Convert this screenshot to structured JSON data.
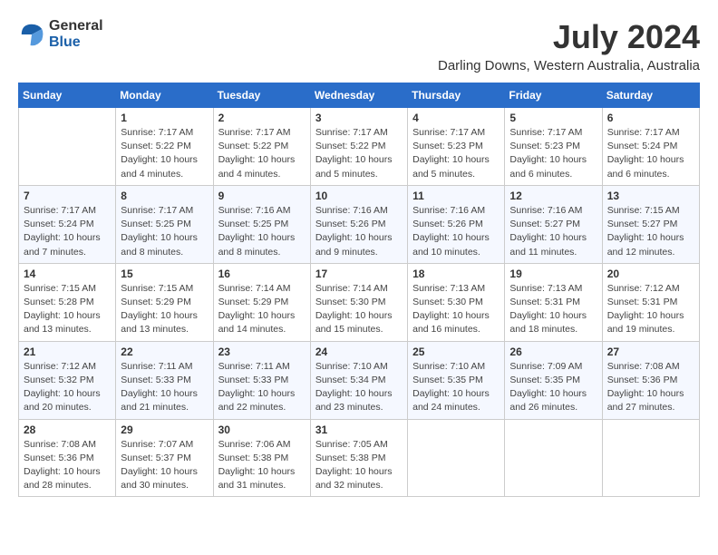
{
  "header": {
    "logo_line1": "General",
    "logo_line2": "Blue",
    "month": "July 2024",
    "location": "Darling Downs, Western Australia, Australia"
  },
  "days_of_week": [
    "Sunday",
    "Monday",
    "Tuesday",
    "Wednesday",
    "Thursday",
    "Friday",
    "Saturday"
  ],
  "weeks": [
    [
      {
        "day": "",
        "info": ""
      },
      {
        "day": "1",
        "info": "Sunrise: 7:17 AM\nSunset: 5:22 PM\nDaylight: 10 hours\nand 4 minutes."
      },
      {
        "day": "2",
        "info": "Sunrise: 7:17 AM\nSunset: 5:22 PM\nDaylight: 10 hours\nand 4 minutes."
      },
      {
        "day": "3",
        "info": "Sunrise: 7:17 AM\nSunset: 5:22 PM\nDaylight: 10 hours\nand 5 minutes."
      },
      {
        "day": "4",
        "info": "Sunrise: 7:17 AM\nSunset: 5:23 PM\nDaylight: 10 hours\nand 5 minutes."
      },
      {
        "day": "5",
        "info": "Sunrise: 7:17 AM\nSunset: 5:23 PM\nDaylight: 10 hours\nand 6 minutes."
      },
      {
        "day": "6",
        "info": "Sunrise: 7:17 AM\nSunset: 5:24 PM\nDaylight: 10 hours\nand 6 minutes."
      }
    ],
    [
      {
        "day": "7",
        "info": "Sunrise: 7:17 AM\nSunset: 5:24 PM\nDaylight: 10 hours\nand 7 minutes."
      },
      {
        "day": "8",
        "info": "Sunrise: 7:17 AM\nSunset: 5:25 PM\nDaylight: 10 hours\nand 8 minutes."
      },
      {
        "day": "9",
        "info": "Sunrise: 7:16 AM\nSunset: 5:25 PM\nDaylight: 10 hours\nand 8 minutes."
      },
      {
        "day": "10",
        "info": "Sunrise: 7:16 AM\nSunset: 5:26 PM\nDaylight: 10 hours\nand 9 minutes."
      },
      {
        "day": "11",
        "info": "Sunrise: 7:16 AM\nSunset: 5:26 PM\nDaylight: 10 hours\nand 10 minutes."
      },
      {
        "day": "12",
        "info": "Sunrise: 7:16 AM\nSunset: 5:27 PM\nDaylight: 10 hours\nand 11 minutes."
      },
      {
        "day": "13",
        "info": "Sunrise: 7:15 AM\nSunset: 5:27 PM\nDaylight: 10 hours\nand 12 minutes."
      }
    ],
    [
      {
        "day": "14",
        "info": "Sunrise: 7:15 AM\nSunset: 5:28 PM\nDaylight: 10 hours\nand 13 minutes."
      },
      {
        "day": "15",
        "info": "Sunrise: 7:15 AM\nSunset: 5:29 PM\nDaylight: 10 hours\nand 13 minutes."
      },
      {
        "day": "16",
        "info": "Sunrise: 7:14 AM\nSunset: 5:29 PM\nDaylight: 10 hours\nand 14 minutes."
      },
      {
        "day": "17",
        "info": "Sunrise: 7:14 AM\nSunset: 5:30 PM\nDaylight: 10 hours\nand 15 minutes."
      },
      {
        "day": "18",
        "info": "Sunrise: 7:13 AM\nSunset: 5:30 PM\nDaylight: 10 hours\nand 16 minutes."
      },
      {
        "day": "19",
        "info": "Sunrise: 7:13 AM\nSunset: 5:31 PM\nDaylight: 10 hours\nand 18 minutes."
      },
      {
        "day": "20",
        "info": "Sunrise: 7:12 AM\nSunset: 5:31 PM\nDaylight: 10 hours\nand 19 minutes."
      }
    ],
    [
      {
        "day": "21",
        "info": "Sunrise: 7:12 AM\nSunset: 5:32 PM\nDaylight: 10 hours\nand 20 minutes."
      },
      {
        "day": "22",
        "info": "Sunrise: 7:11 AM\nSunset: 5:33 PM\nDaylight: 10 hours\nand 21 minutes."
      },
      {
        "day": "23",
        "info": "Sunrise: 7:11 AM\nSunset: 5:33 PM\nDaylight: 10 hours\nand 22 minutes."
      },
      {
        "day": "24",
        "info": "Sunrise: 7:10 AM\nSunset: 5:34 PM\nDaylight: 10 hours\nand 23 minutes."
      },
      {
        "day": "25",
        "info": "Sunrise: 7:10 AM\nSunset: 5:35 PM\nDaylight: 10 hours\nand 24 minutes."
      },
      {
        "day": "26",
        "info": "Sunrise: 7:09 AM\nSunset: 5:35 PM\nDaylight: 10 hours\nand 26 minutes."
      },
      {
        "day": "27",
        "info": "Sunrise: 7:08 AM\nSunset: 5:36 PM\nDaylight: 10 hours\nand 27 minutes."
      }
    ],
    [
      {
        "day": "28",
        "info": "Sunrise: 7:08 AM\nSunset: 5:36 PM\nDaylight: 10 hours\nand 28 minutes."
      },
      {
        "day": "29",
        "info": "Sunrise: 7:07 AM\nSunset: 5:37 PM\nDaylight: 10 hours\nand 30 minutes."
      },
      {
        "day": "30",
        "info": "Sunrise: 7:06 AM\nSunset: 5:38 PM\nDaylight: 10 hours\nand 31 minutes."
      },
      {
        "day": "31",
        "info": "Sunrise: 7:05 AM\nSunset: 5:38 PM\nDaylight: 10 hours\nand 32 minutes."
      },
      {
        "day": "",
        "info": ""
      },
      {
        "day": "",
        "info": ""
      },
      {
        "day": "",
        "info": ""
      }
    ]
  ]
}
